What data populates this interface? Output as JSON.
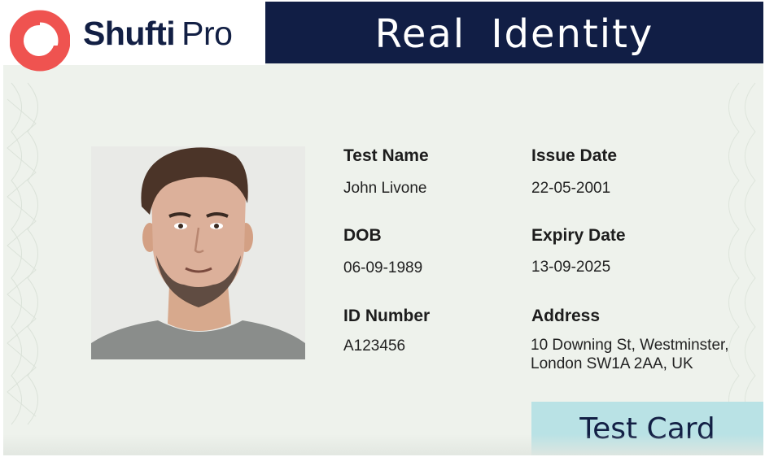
{
  "brand": {
    "name_bold": "Shufti",
    "name_light": "Pro",
    "logo_color": "#ef5350"
  },
  "header": {
    "title": "Real Identity",
    "background": "#111e45"
  },
  "photo": {
    "alt": "portrait"
  },
  "fields": {
    "name": {
      "label": "Test Name",
      "value": "John Livone"
    },
    "issue": {
      "label": "Issue Date",
      "value": "22-05-2001"
    },
    "dob": {
      "label": "DOB",
      "value": "06-09-1989"
    },
    "expiry": {
      "label": "Expiry Date",
      "value": "13-09-2025"
    },
    "id": {
      "label": "ID Number",
      "value": "A123456"
    },
    "address": {
      "label": "Address",
      "line1": "10 Downing St, Westminster,",
      "line2": "London SW1A 2AA, UK"
    }
  },
  "badge": {
    "label": "Test Card",
    "background": "#b9e2e5"
  }
}
